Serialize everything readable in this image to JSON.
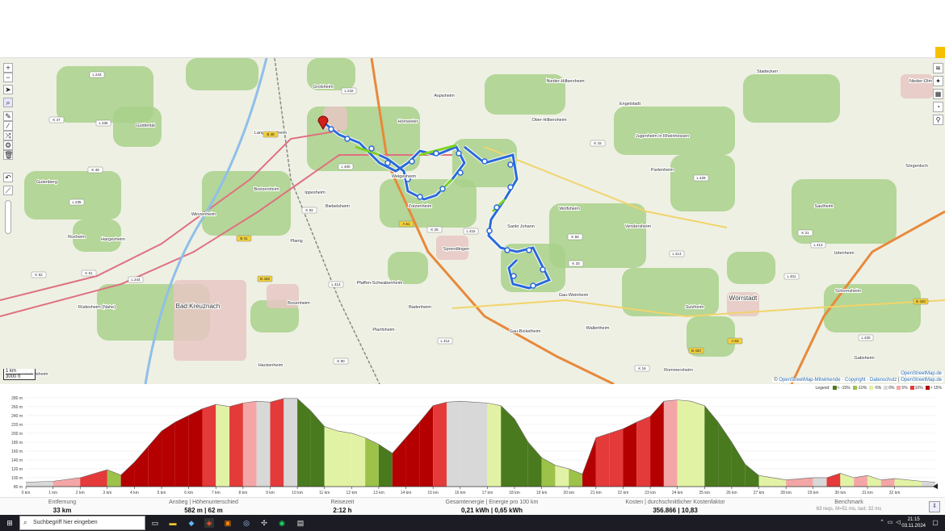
{
  "map": {
    "places": [
      {
        "name": "Grolsheim"
      },
      {
        "name": "Aspisheim"
      },
      {
        "name": "Horrweiler"
      },
      {
        "name": "Ober-Hilbersheim"
      },
      {
        "name": "Nieder-Hilbersheim"
      },
      {
        "name": "Engelstadt"
      },
      {
        "name": "Stadecken"
      },
      {
        "name": "Jugenheim in Rheinhessen"
      },
      {
        "name": "Partenheim"
      },
      {
        "name": "Saulheim"
      },
      {
        "name": "Langenlonsheim"
      },
      {
        "name": "Guldental"
      },
      {
        "name": "Bretzenheim"
      },
      {
        "name": "Gutenberg"
      },
      {
        "name": "Welgesheim"
      },
      {
        "name": "Zotzenheim"
      },
      {
        "name": "Ippesheim"
      },
      {
        "name": "Biebelsheim"
      },
      {
        "name": "Sprendlingen"
      },
      {
        "name": "Sankt Johann"
      },
      {
        "name": "Wolfsheim"
      },
      {
        "name": "Vendersheim"
      },
      {
        "name": "Winzenheim"
      },
      {
        "name": "Hargesheim"
      },
      {
        "name": "Roxheim"
      },
      {
        "name": "Planig"
      },
      {
        "name": "Pfaffen-Schwabenheim"
      },
      {
        "name": "Badenheim"
      },
      {
        "name": "Gau-Weinheim"
      },
      {
        "name": "Udenheim"
      },
      {
        "name": "Schornsheim"
      },
      {
        "name": "Rüdesheim (Nahe)"
      },
      {
        "name": "Bad Kreuznach"
      },
      {
        "name": "Bosenheim"
      },
      {
        "name": "Planfsheim"
      },
      {
        "name": "Sulzheim"
      },
      {
        "name": "Wörrstadt"
      },
      {
        "name": "Gau-Bickelheim"
      },
      {
        "name": "Wallertheim"
      },
      {
        "name": "Hackenheim"
      },
      {
        "name": "Rommersheim"
      },
      {
        "name": "Hüffelsheim"
      },
      {
        "name": "Gabsheim"
      },
      {
        "name": "Sörgenloch"
      },
      {
        "name": "Nieder-Olm"
      }
    ],
    "road_labels": [
      {
        "name": "L 243"
      },
      {
        "name": "K 47"
      },
      {
        "name": "L 236"
      },
      {
        "name": "L 242"
      },
      {
        "name": "B 48"
      },
      {
        "name": "K 49"
      },
      {
        "name": "L 235"
      },
      {
        "name": "B 41"
      },
      {
        "name": "K 52"
      },
      {
        "name": "K 51"
      },
      {
        "name": "L 244"
      },
      {
        "name": "B 428"
      },
      {
        "name": "L 413"
      },
      {
        "name": "K 92"
      },
      {
        "name": "L 400"
      },
      {
        "name": "A 61"
      },
      {
        "name": "K 26"
      },
      {
        "name": "L 415"
      },
      {
        "name": "L 414"
      },
      {
        "name": "K 50"
      },
      {
        "name": "K 33"
      },
      {
        "name": "L 429"
      },
      {
        "name": "L 401"
      },
      {
        "name": "K 15"
      },
      {
        "name": "L 413"
      },
      {
        "name": "A 63"
      },
      {
        "name": "B 420"
      },
      {
        "name": "K 16"
      },
      {
        "name": "K 21"
      },
      {
        "name": "L 430"
      },
      {
        "name": "K 90"
      },
      {
        "name": "L 412"
      },
      {
        "name": "B 420"
      }
    ],
    "scale": {
      "metric": "1 km",
      "imperial": "3000 ft"
    },
    "attribution": {
      "prefix": "© ",
      "osm": "OpenStreetMap-Mitwirkende",
      "copyright": "Copyright",
      "privacy": "Datenschutz",
      "tiles": "OpenStreetMap.de",
      "top": "OpenStreetMap.de"
    },
    "left_controls": [
      "zoom-in",
      "zoom-out",
      "locate",
      "search",
      "draw",
      "route",
      "shuffle",
      "settings",
      "delete",
      "undo",
      "profile"
    ],
    "right_controls": [
      "layers",
      "tools",
      "table",
      "pie",
      "pin"
    ]
  },
  "profile": {
    "legend_title": "Legend:",
    "legend": [
      {
        "label": "< -15%",
        "color": "#4a7a1e"
      },
      {
        "label": "-10%",
        "color": "#9cc24a"
      },
      {
        "label": "-5%",
        "color": "#e2f2a4"
      },
      {
        "label": "0%",
        "color": "#d8d8d8"
      },
      {
        "label": "5%",
        "color": "#f4a6a6"
      },
      {
        "label": "10%",
        "color": "#e43a3a"
      },
      {
        "label": "> 15%",
        "color": "#b40000"
      }
    ],
    "y_ticks": [
      "280 m",
      "260 m",
      "240 m",
      "220 m",
      "200 m",
      "180 m",
      "160 m",
      "140 m",
      "120 m",
      "100 m",
      "80 m"
    ],
    "x_ticks": [
      "0 km",
      "1 km",
      "2 km",
      "3 km",
      "4 km",
      "5 km",
      "6 km",
      "7 km",
      "8 km",
      "9 km",
      "10 km",
      "11 km",
      "12 km",
      "13 km",
      "14 km",
      "15 km",
      "16 km",
      "17 km",
      "18 km",
      "19 km",
      "20 km",
      "21 km",
      "22 km",
      "23 km",
      "24 km",
      "25 km",
      "26 km",
      "27 km",
      "28 km",
      "29 km",
      "30 km",
      "31 km",
      "32 km"
    ]
  },
  "stats": {
    "distance": {
      "label": "Entfernung",
      "value": "33 km"
    },
    "ascent": {
      "label": "Anstieg | Höhenunterschied",
      "value": "582 m | 62 m"
    },
    "time": {
      "label": "Reisezeit",
      "value": "2:12 h"
    },
    "energy": {
      "label": "Gesamtenergie | Energie pro 100 km",
      "value": "0,21 kWh | 0,65 kWh"
    },
    "cost": {
      "label": "Kosten | durchschnittlicher Kostenfaktor",
      "value": "356.866 | 10,83"
    },
    "benchmark": {
      "label": "Benchmark",
      "value": "63 reqs, M=51 ms, last: 32 ms"
    }
  },
  "chart_data": {
    "type": "area",
    "title": "",
    "xlabel": "",
    "ylabel": "",
    "xlim": [
      0,
      33.5
    ],
    "ylim": [
      80,
      285
    ],
    "x": [
      0,
      1,
      2,
      3,
      3.5,
      4,
      4.5,
      5,
      5.5,
      6,
      6.5,
      7,
      7.5,
      8,
      8.5,
      9,
      9.5,
      10,
      10.5,
      11,
      11.5,
      12,
      12.5,
      13,
      13.5,
      14,
      14.5,
      15,
      15.5,
      16,
      16.5,
      17,
      17.5,
      18,
      18.5,
      19,
      19.5,
      20,
      20.5,
      21,
      21.5,
      22,
      22.5,
      23,
      23.5,
      24,
      24.5,
      25,
      25.5,
      26,
      26.5,
      27,
      27.5,
      28,
      29,
      29.5,
      30,
      30.5,
      31,
      31.5,
      32,
      33,
      33.5
    ],
    "y": [
      90,
      92,
      100,
      118,
      106,
      135,
      170,
      205,
      225,
      240,
      255,
      265,
      260,
      268,
      272,
      270,
      278,
      278,
      250,
      215,
      205,
      200,
      190,
      175,
      155,
      190,
      225,
      262,
      270,
      272,
      270,
      268,
      262,
      232,
      180,
      145,
      128,
      120,
      108,
      190,
      200,
      210,
      225,
      238,
      272,
      275,
      272,
      262,
      225,
      180,
      130,
      105,
      100,
      95,
      100,
      100,
      110,
      100,
      105,
      95,
      98,
      92,
      90
    ]
  },
  "taskbar": {
    "search_placeholder": "Suchbegriff hier eingeben",
    "time": "21:15",
    "date": "03.11.2024"
  }
}
